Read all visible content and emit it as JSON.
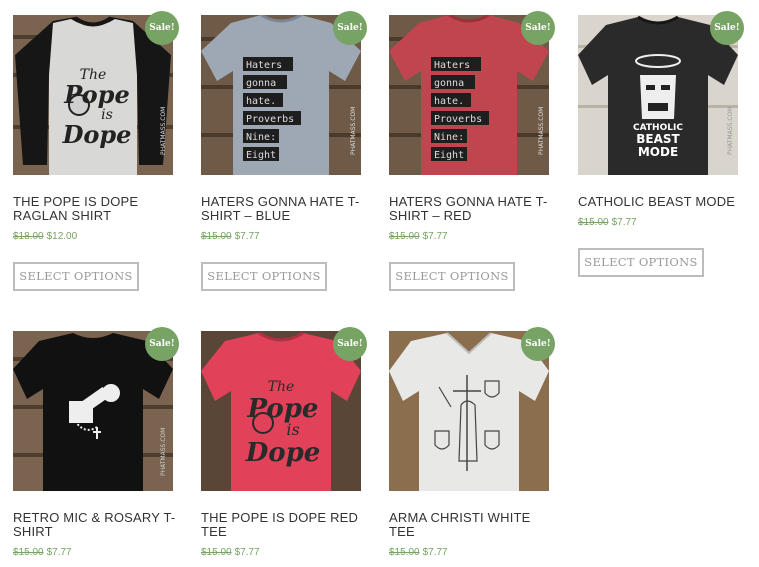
{
  "sale_label": "Sale!",
  "button_label": "SELECT OPTIONS",
  "watermark": "PHATMASS.COM",
  "products": [
    {
      "title": "THE POPE IS DOPE RAGLAN SHIRT",
      "old_price": "$18.00",
      "new_price": "$12.00",
      "print": [
        "The",
        "Pope",
        "is",
        "Dope"
      ]
    },
    {
      "title": "HATERS GONNA HATE T-SHIRT – BLUE",
      "old_price": "$15.00",
      "new_price": "$7.77",
      "print": [
        "Haters",
        "gonna",
        "hate.",
        "Proverbs",
        "Nine:",
        "Eight"
      ]
    },
    {
      "title": "HATERS GONNA HATE T-SHIRT – RED",
      "old_price": "$15.00",
      "new_price": "$7.77",
      "print": [
        "Haters",
        "gonna",
        "hate.",
        "Proverbs",
        "Nine:",
        "Eight"
      ]
    },
    {
      "title": "CATHOLIC BEAST MODE",
      "old_price": "$15.00",
      "new_price": "$7.77",
      "print": [
        "CATHOLIC",
        "BEAST",
        "MODE"
      ]
    },
    {
      "title": "RETRO MIC & ROSARY T-SHIRT",
      "old_price": "$15.00",
      "new_price": "$7.77"
    },
    {
      "title": "THE POPE IS DOPE RED TEE",
      "old_price": "$15.00",
      "new_price": "$7.77",
      "print": [
        "The",
        "Pope",
        "is",
        "Dope"
      ]
    },
    {
      "title": "ARMA CHRISTI WHITE TEE",
      "old_price": "$15.00",
      "new_price": "$7.77"
    }
  ],
  "colors": {
    "sale_badge": "#77a464",
    "price": "#77a464",
    "button_border": "#bdbdbd",
    "title_text": "#333333"
  }
}
